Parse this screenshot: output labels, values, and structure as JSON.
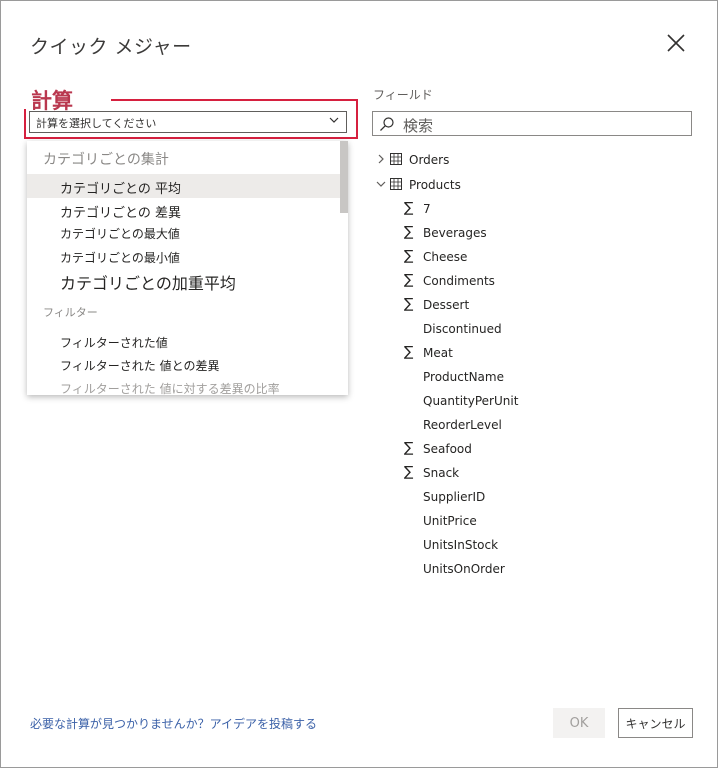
{
  "dialog": {
    "title": "クイック メジャー",
    "close_icon": "close-icon"
  },
  "calculation": {
    "label": "計算",
    "select_placeholder": "計算を選択してください",
    "chevron": "⌵"
  },
  "dropdown": {
    "groups": [
      {
        "title": "カテゴリごとの集計",
        "items": [
          "カテゴリごとの 平均",
          "カテゴリごとの 差異",
          "カテゴリごとの最大値",
          "カテゴリごとの最小値",
          "カテゴリごとの加重平均"
        ],
        "selected_index": 0
      },
      {
        "title": "フィルター",
        "items": [
          "フィルターされた値",
          "フィルターされた 値との差異",
          "フィルターされた 値に対する差異の比率"
        ]
      }
    ]
  },
  "fields": {
    "label": "フィールド",
    "search_placeholder": "検索",
    "tables": [
      {
        "name": "Orders",
        "expanded": false
      },
      {
        "name": "Products",
        "expanded": true
      }
    ],
    "product_fields": [
      {
        "name": "7",
        "sigma": true
      },
      {
        "name": "Beverages",
        "sigma": true
      },
      {
        "name": "Cheese",
        "sigma": true
      },
      {
        "name": "Condiments",
        "sigma": true
      },
      {
        "name": "Dessert",
        "sigma": true
      },
      {
        "name": "Discontinued",
        "sigma": false
      },
      {
        "name": "Meat",
        "sigma": true
      },
      {
        "name": "ProductName",
        "sigma": false
      },
      {
        "name": "QuantityPerUnit",
        "sigma": false
      },
      {
        "name": "ReorderLevel",
        "sigma": false
      },
      {
        "name": "Seafood",
        "sigma": true
      },
      {
        "name": "Snack",
        "sigma": true
      },
      {
        "name": "SupplierID",
        "sigma": false
      },
      {
        "name": "UnitPrice",
        "sigma": false
      },
      {
        "name": "UnitsInStock",
        "sigma": false
      },
      {
        "name": "UnitsOnOrder",
        "sigma": false
      }
    ],
    "sigma_glyph": "∑"
  },
  "footer": {
    "link_text": "必要な計算が見つかりませんか？アイデアを投稿する",
    "ok_label": "OK",
    "cancel_label": "キャンセル"
  },
  "colors": {
    "accent_label": "#b9374e",
    "highlight_border": "#d6203f",
    "link": "#3b61a8",
    "selected_bg": "#edebe9"
  }
}
